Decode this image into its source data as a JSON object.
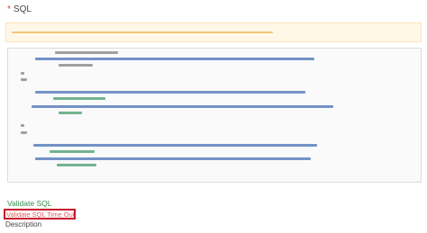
{
  "sql_field": {
    "required_mark": "*",
    "label": "SQL"
  },
  "validate": {
    "link_label": "Validate SQL",
    "error_message": "Validate SQL Time Out"
  },
  "description_field": {
    "label": "Description"
  },
  "colors": {
    "required": "#e0403a",
    "validate_link": "#2f8a4a",
    "error_text": "#e25a5a",
    "highlight_border": "#c8102e",
    "notice_background": "#fff8e8"
  }
}
